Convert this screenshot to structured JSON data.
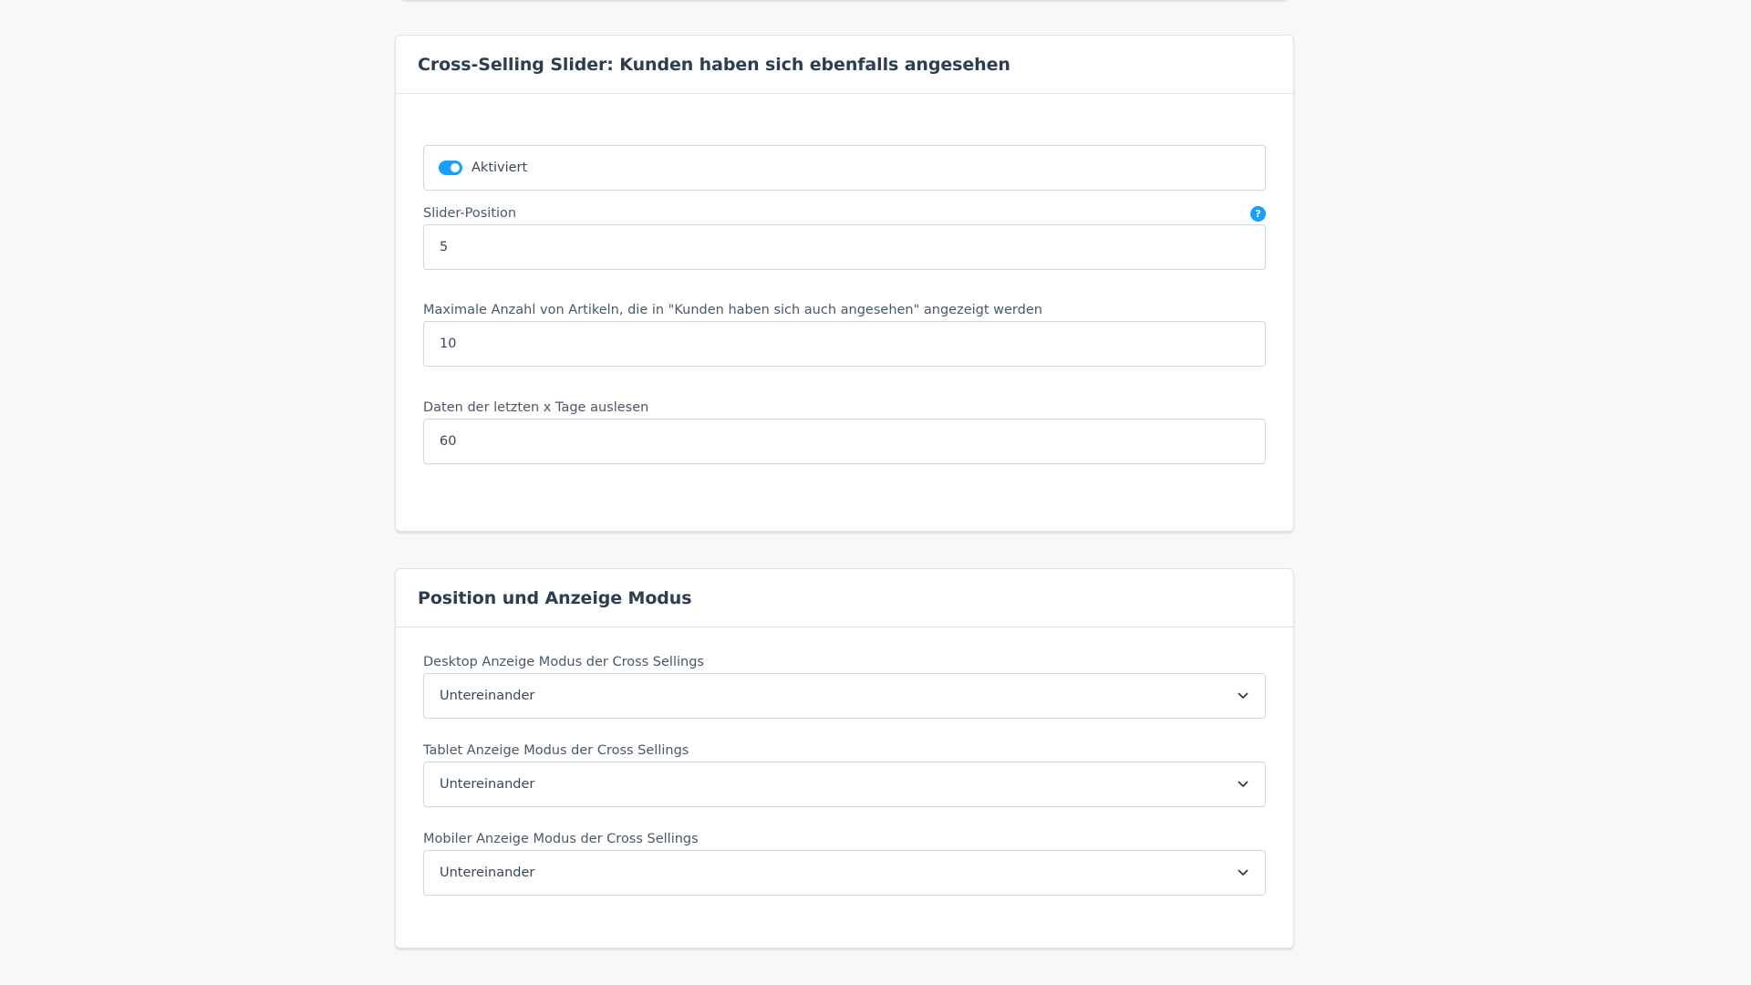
{
  "card1": {
    "title": "Cross-Selling Slider: Kunden haben sich ebenfalls angesehen",
    "switch": {
      "label": "Aktiviert",
      "checked": true
    },
    "slider_position": {
      "label": "Slider-Position",
      "value": "5"
    },
    "max_articles": {
      "label": "Maximale Anzahl von Artikeln, die in \"Kunden haben sich auch angesehen\" angezeigt werden",
      "value": "10"
    },
    "days": {
      "label": "Daten der letzten x Tage auslesen",
      "value": "60"
    }
  },
  "card2": {
    "title": "Position und Anzeige Modus",
    "desktop": {
      "label": "Desktop Anzeige Modus der Cross Sellings",
      "value": "Untereinander"
    },
    "tablet": {
      "label": "Tablet Anzeige Modus der Cross Sellings",
      "value": "Untereinander"
    },
    "mobile": {
      "label": "Mobiler Anzeige Modus der Cross Sellings",
      "value": "Untereinander"
    }
  },
  "icons": {
    "help": "help-icon",
    "chevron": "chevron-down-icon"
  },
  "colors": {
    "accent": "#189eff",
    "background": "#f7f8fa",
    "border": "#d1d7de"
  }
}
